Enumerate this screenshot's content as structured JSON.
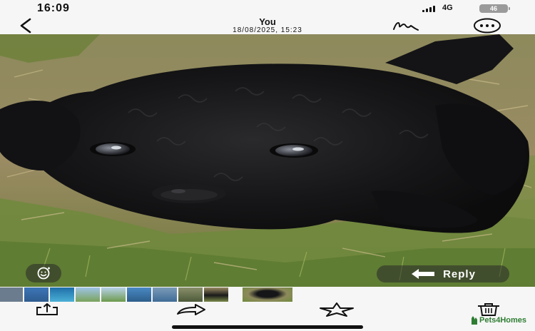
{
  "status_bar": {
    "time": "16:09",
    "network": "4G",
    "battery": "46"
  },
  "header": {
    "title": "You",
    "subtitle": "18/08/2025, 15:23"
  },
  "photo": {
    "subject_icon": "puppy-photo"
  },
  "actions": {
    "reply_label": "Reply"
  },
  "thumbnails": {
    "count": 9
  },
  "watermark": {
    "text": "Pets4Homes"
  },
  "colors": {
    "bar_background": "#f6f6f6",
    "watermark_green": "#2e7d32",
    "overlay_button": "#282828"
  }
}
